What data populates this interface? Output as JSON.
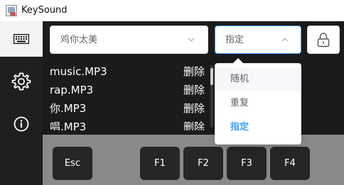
{
  "window": {
    "title": "KeySound"
  },
  "sidebar": {
    "items": [
      {
        "icon": "keyboard-icon"
      },
      {
        "icon": "gear-icon"
      },
      {
        "icon": "info-icon"
      }
    ]
  },
  "controls": {
    "song_select": {
      "value": "鸡你太美"
    },
    "mode_select": {
      "value": "指定"
    },
    "lock_icon": "lock-icon"
  },
  "songs": [
    {
      "name": "music.MP3",
      "delete_label": "删除"
    },
    {
      "name": "rap.MP3",
      "delete_label": "删除"
    },
    {
      "name": "你.MP3",
      "delete_label": "删除"
    },
    {
      "name": "唱.MP3",
      "delete_label": "删除"
    }
  ],
  "keys": [
    {
      "label": "Esc"
    },
    {
      "label": "F1"
    },
    {
      "label": "F2"
    },
    {
      "label": "F3"
    },
    {
      "label": "F4"
    }
  ],
  "mode_dropdown": {
    "options": [
      {
        "label": "随机"
      },
      {
        "label": "重复"
      },
      {
        "label": "指定"
      }
    ],
    "selected": "指定"
  },
  "colors": {
    "accent": "#409eff",
    "sidebar_bg": "#1f1f1f",
    "main_bg": "#1b1b1b",
    "keys_area_bg": "#8a8a8a",
    "key_bg": "#262626"
  }
}
